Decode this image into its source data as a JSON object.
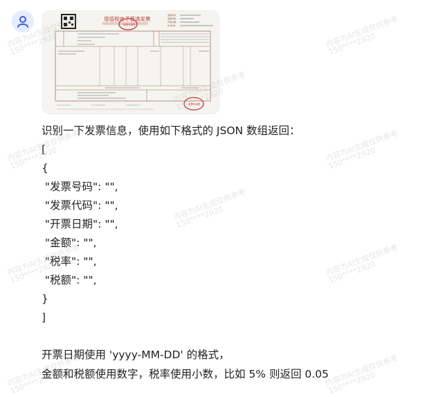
{
  "user": {
    "avatar_icon": "user-icon",
    "accent": "#3a5be0"
  },
  "attachment": {
    "type": "invoice-image",
    "title": "增值税电子普通发票"
  },
  "message": {
    "lines": [
      "识别一下发票信息，使用如下格式的 JSON 数组返回：",
      "[",
      "{",
      " \"发票号码\": \"\",",
      " \"发票代码\": \"\",",
      " \"开票日期\": \"\",",
      " \"金额\": \"\",",
      " \"税率\": \"\",",
      " \"税额\": \"\",",
      "}",
      "]",
      "",
      "开票日期使用 'yyyy-MM-DD' 的格式，",
      "金额和税额使用数字，税率使用小数，比如 5% 则返回 0.05"
    ]
  },
  "watermark": {
    "line1": "内容为AI生成仅供参考",
    "line2": "150****2920"
  }
}
